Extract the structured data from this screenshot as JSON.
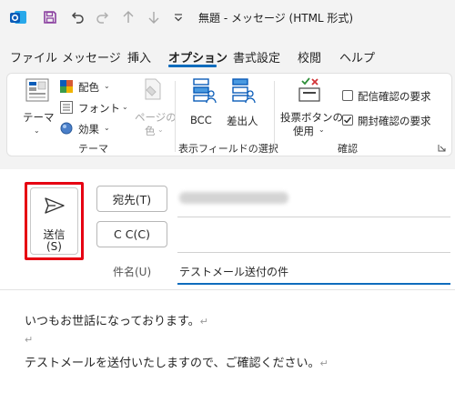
{
  "window": {
    "title": "無題 - メッセージ (HTML 形式)"
  },
  "tabs": [
    {
      "label": "ファイル",
      "active": false
    },
    {
      "label": "メッセージ",
      "active": false
    },
    {
      "label": "挿入",
      "active": false
    },
    {
      "label": "オプション",
      "active": true
    },
    {
      "label": "書式設定",
      "active": false
    },
    {
      "label": "校閲",
      "active": false
    },
    {
      "label": "ヘルプ",
      "active": false
    }
  ],
  "ribbon": {
    "theme_label": "テーマ",
    "colors_label": "配色",
    "fonts_label": "フォント",
    "effects_label": "効果",
    "page_color_line1": "ページの",
    "page_color_line2": "色",
    "group_theme": "テーマ",
    "bcc_label": "BCC",
    "from_label": "差出人",
    "group_show_fields": "表示フィールドの選択",
    "voting_line1": "投票ボタンの",
    "voting_line2": "使用",
    "delivery_receipt": "配信確認の要求",
    "read_receipt": "開封確認の要求",
    "delivery_checked": false,
    "read_checked": true,
    "group_tracking": "確認"
  },
  "compose": {
    "send_line1": "送信",
    "send_line2": "(S)",
    "to_button": "宛先(T)",
    "cc_button": "C C(C)",
    "subject_label": "件名(U)",
    "subject_value": "テストメール送付の件",
    "body_lines": [
      "いつもお世話になっております。",
      "",
      "テストメールを送付いたしますので、ご確認ください。"
    ],
    "paragraph_mark": "↵"
  },
  "colors": {
    "accent": "#0f6cbd",
    "highlight": "#e60012",
    "outlook_blue": "#0a5cb8",
    "save_purple": "#8a3fa0"
  }
}
